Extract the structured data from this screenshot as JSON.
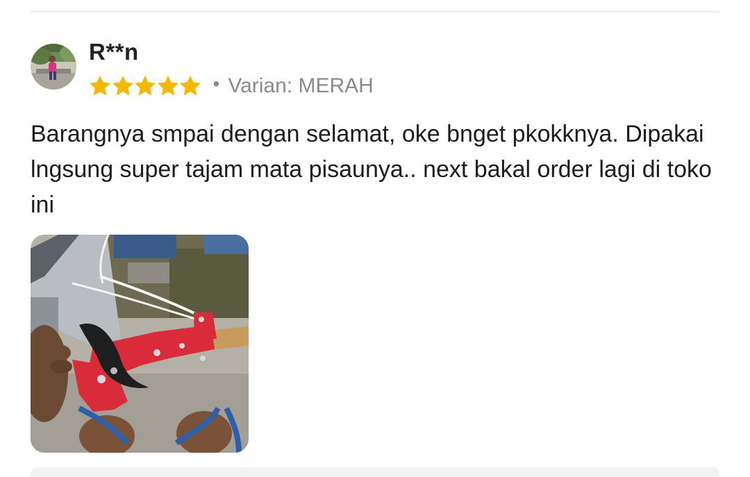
{
  "review": {
    "reviewer_name": "R**n",
    "rating": 5,
    "rating_max": 5,
    "star_color": "#f5b800",
    "variant_label": "Varian: MERAH",
    "text": "Barangnya smpai dengan selamat, oke bnget pkokknya. Dipakai lngsung super tajam mata pisaunya.. next bakal order lagi di toko ini",
    "photo_icon": "review-photo-pruning-shears"
  }
}
